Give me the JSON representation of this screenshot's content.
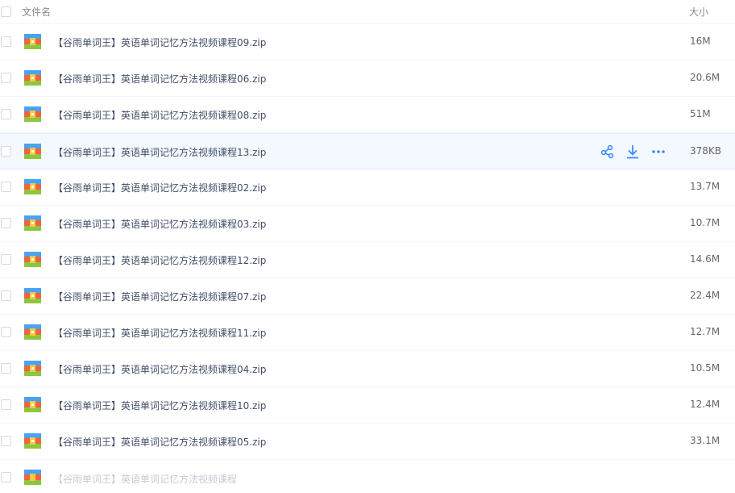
{
  "header": {
    "name_label": "文件名",
    "size_label": "大小"
  },
  "rows": [
    {
      "name": "【谷雨单词王】英语单词记忆方法视频课程09.zip",
      "size": "16M"
    },
    {
      "name": "【谷雨单词王】英语单词记忆方法视频课程06.zip",
      "size": "20.6M"
    },
    {
      "name": "【谷雨单词王】英语单词记忆方法视频课程08.zip",
      "size": "51M"
    },
    {
      "name": "【谷雨单词王】英语单词记忆方法视频课程13.zip",
      "size": "378KB"
    },
    {
      "name": "【谷雨单词王】英语单词记忆方法视频课程02.zip",
      "size": "13.7M"
    },
    {
      "name": "【谷雨单词王】英语单词记忆方法视频课程03.zip",
      "size": "10.7M"
    },
    {
      "name": "【谷雨单词王】英语单词记忆方法视频课程12.zip",
      "size": "14.6M"
    },
    {
      "name": "【谷雨单词王】英语单词记忆方法视频课程07.zip",
      "size": "22.4M"
    },
    {
      "name": "【谷雨单词王】英语单词记忆方法视频课程11.zip",
      "size": "12.7M"
    },
    {
      "name": "【谷雨单词王】英语单词记忆方法视频课程04.zip",
      "size": "10.5M"
    },
    {
      "name": "【谷雨单词王】英语单词记忆方法视频课程10.zip",
      "size": "12.4M"
    },
    {
      "name": "【谷雨单词王】英语单词记忆方法视频课程05.zip",
      "size": "33.1M"
    }
  ],
  "partial_row": {
    "name": "【谷雨单词王】英语单词记忆方法视频课程"
  },
  "hovered_row_index": 3,
  "row_actions": [
    "share-icon",
    "download-icon",
    "more-icon"
  ],
  "colors": {
    "accent": "#3b8cff",
    "hover_bg": "#f4f8ff",
    "divider": "#f2f6fd"
  }
}
